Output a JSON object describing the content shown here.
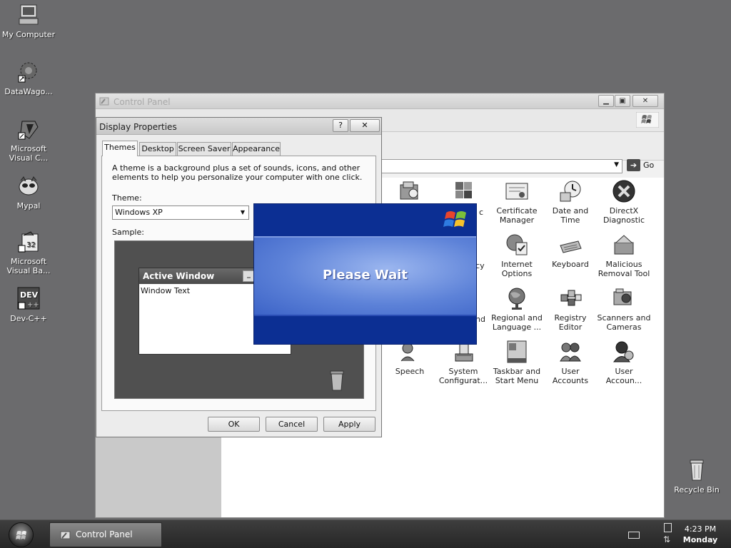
{
  "desktop": {
    "icons": [
      {
        "label": "My Computer",
        "icon": "computer-icon"
      },
      {
        "label": "DataWago...",
        "icon": "datawagon-icon"
      },
      {
        "label": "Microsoft Visual C...",
        "icon": "visual-c-icon"
      },
      {
        "label": "Mypal",
        "icon": "mypal-icon"
      },
      {
        "label": "Microsoft Visual Ba...",
        "icon": "visual-basic-icon"
      },
      {
        "label": "Dev-C++",
        "icon": "dev-cpp-icon"
      },
      {
        "label": "Recycle Bin",
        "icon": "recycle-bin-icon"
      }
    ]
  },
  "control_panel": {
    "title": "Control Panel",
    "go_label": "Go",
    "items": [
      {
        "label": "",
        "icon": "folder-options-icon"
      },
      {
        "label": "",
        "icon": "windows-flag-icon"
      },
      {
        "label": "Certificate Manager",
        "icon": "certificate-icon"
      },
      {
        "label": "Date and Time",
        "icon": "clock-icon"
      },
      {
        "label": "DirectX Diagnostic",
        "icon": "directx-icon"
      },
      {
        "label": "Internet Options",
        "icon": "internet-options-icon"
      },
      {
        "label": "Keyboard",
        "icon": "keyboard-icon"
      },
      {
        "label": "Malicious Removal Tool",
        "icon": "malicious-removal-icon"
      },
      {
        "label": "Regional and Language ...",
        "icon": "globe-icon"
      },
      {
        "label": "Registry Editor",
        "icon": "registry-icon"
      },
      {
        "label": "Scanners and Cameras",
        "icon": "scanner-icon"
      },
      {
        "label": "Speech",
        "icon": "speech-icon"
      },
      {
        "label": "System Configurat...",
        "icon": "system-config-icon"
      },
      {
        "label": "Taskbar and Start Menu",
        "icon": "taskbar-icon"
      },
      {
        "label": "User Accounts",
        "icon": "users-icon"
      },
      {
        "label": "User Accoun...",
        "icon": "user-account-icon"
      }
    ],
    "partial_labels": [
      "c",
      "icy",
      "nd"
    ]
  },
  "display_properties": {
    "title": "Display Properties",
    "help_label": "?",
    "close_label": "✕",
    "tabs": [
      "Themes",
      "Desktop",
      "Screen Saver",
      "Appearance"
    ],
    "description": "A theme is a background plus a set of sounds, icons, and other elements to help you personalize your computer with one click.",
    "theme_label": "Theme:",
    "theme_value": "Windows XP",
    "sample_label": "Sample:",
    "sample_window_title": "Active Window",
    "sample_window_text": "Window Text",
    "buttons": {
      "ok": "OK",
      "cancel": "Cancel",
      "apply": "Apply"
    }
  },
  "please_wait": {
    "text": "Please Wait"
  },
  "taskbar": {
    "task_label": "Control Panel",
    "time": "4:23 PM",
    "day": "Monday"
  }
}
